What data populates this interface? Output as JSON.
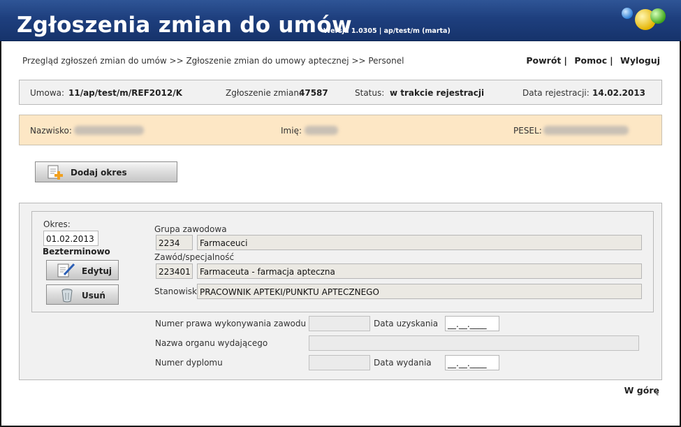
{
  "header": {
    "title": "Zgłoszenia zmian do umów",
    "version": "Wersja 1.0305 | ap/test/m (marta)"
  },
  "breadcrumb": "Przegląd zgłoszeń zmian do umów >> Zgłoszenie zmian do umowy aptecznej >> Personel",
  "toplinks": {
    "back": "Powrót",
    "help": "Pomoc",
    "logout": "Wyloguj",
    "separator": "|"
  },
  "info": {
    "contract_label": "Umowa:",
    "contract_value": "11/ap/test/m/REF2012/K",
    "request_label": "Zgłoszenie zmian:",
    "request_value": "47587",
    "status_label": "Status:",
    "status_value": "w trakcie rejestracji",
    "date_label": "Data rejestracji:",
    "date_value": "14.02.2013"
  },
  "person": {
    "surname_label": "Nazwisko:",
    "name_label": "Imię:",
    "pesel_label": "PESEL:"
  },
  "buttons": {
    "add_period": "Dodaj okres",
    "edit": "Edytuj",
    "delete": "Usuń"
  },
  "period": {
    "label": "Okres:",
    "start": "01.02.2013",
    "end_text": "Bezterminowo",
    "group_label": "Grupa zawodowa",
    "group_code": "2234",
    "group_name": "Farmaceuci",
    "profession_label": "Zawód/specjalność",
    "profession_code": "223401",
    "profession_name": "Farmaceuta - farmacja apteczna",
    "position_label": "Stanowisko",
    "position_value": "PRACOWNIK APTEKI/PUNKTU APTECZNEGO"
  },
  "license": {
    "number_label": "Numer prawa wykonywania zawodu",
    "obtained_label": "Data uzyskania",
    "obtained_value": "__.__.____",
    "issuer_label": "Nazwa organu wydającego",
    "diploma_label": "Numer dyplomu",
    "issued_label": "Data wydania",
    "issued_value": "__.__.____"
  },
  "footer": {
    "top_link": "W górę"
  }
}
